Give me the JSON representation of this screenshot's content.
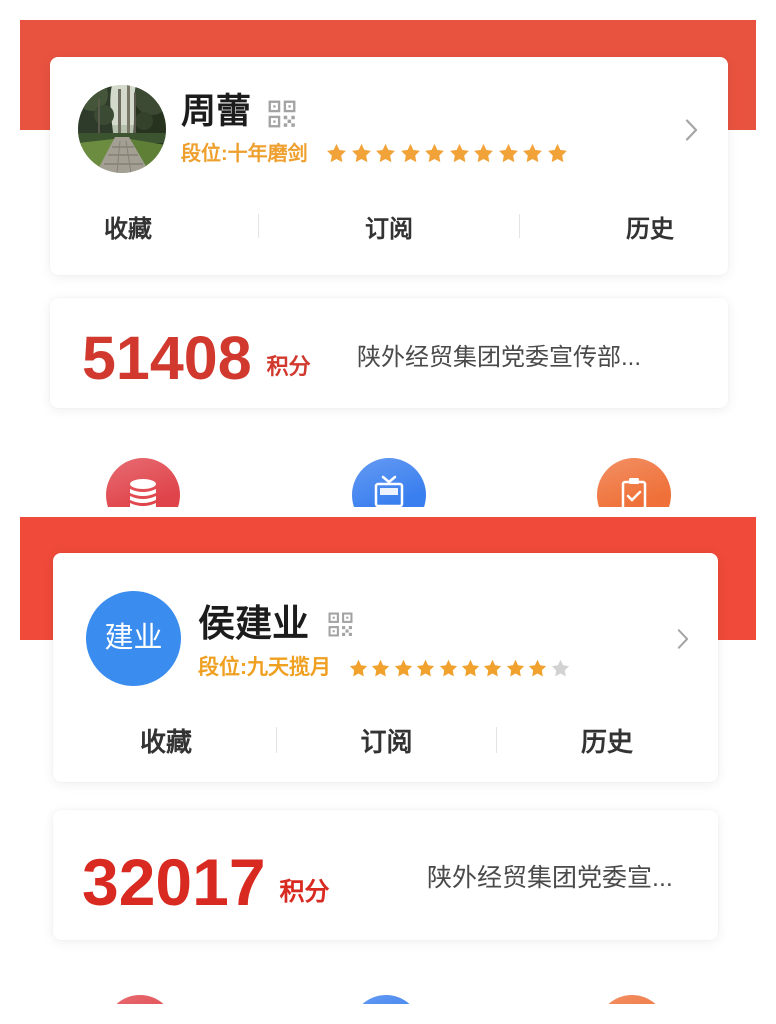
{
  "panels": [
    {
      "colors": {
        "banner": "#e8533f",
        "points": "#d1392e",
        "rank": "#ee9f2d",
        "star": "#f1a238",
        "star_empty": "#d2d2d2"
      },
      "user": {
        "name": "周蕾",
        "avatar_icon": "user-photo-icon",
        "qr_icon": "qr-code-icon",
        "rank_label": "段位:十年磨剑",
        "stars_filled": 10,
        "stars_total": 10,
        "chevron_icon": "chevron-right-icon"
      },
      "tabs": [
        {
          "label": "收藏"
        },
        {
          "label": "订阅"
        },
        {
          "label": "历史"
        }
      ],
      "points": {
        "value": 51408,
        "unit": "积分",
        "org": "陕外经贸集团党委宣传部..."
      },
      "shortcuts": [
        {
          "icon": "coins-icon",
          "color": "#e0444b"
        },
        {
          "icon": "gift-icon",
          "color": "#3a7fef"
        },
        {
          "icon": "clipboard-icon",
          "color": "#ef7139"
        }
      ]
    },
    {
      "colors": {
        "banner": "#ef4a3a",
        "points": "#d82a20",
        "rank": "#efa020",
        "star": "#f1a12e",
        "star_empty": "#d2d2d2",
        "avatar": "#3a8cef"
      },
      "user": {
        "name": "侯建业",
        "avatar_text": "建业",
        "qr_icon": "qr-code-icon",
        "rank_label": "段位:九天揽月",
        "stars_filled": 9,
        "stars_total": 10,
        "chevron_icon": "chevron-right-icon"
      },
      "tabs": [
        {
          "label": "收藏"
        },
        {
          "label": "订阅"
        },
        {
          "label": "历史"
        }
      ],
      "points": {
        "value": 32017,
        "unit": "积分",
        "org": "陕外经贸集团党委宣..."
      },
      "shortcuts": [
        {
          "icon": "coins-icon",
          "color": "#e0444b"
        },
        {
          "icon": "gift-icon",
          "color": "#3a7fef"
        },
        {
          "icon": "clipboard-icon",
          "color": "#ef7139"
        }
      ]
    }
  ]
}
